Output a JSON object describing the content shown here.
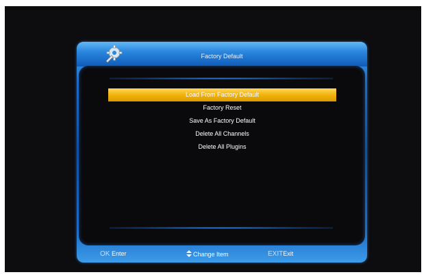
{
  "header": {
    "title": "Factory Default",
    "logo_icon": "gear-wrench-icon"
  },
  "menu": {
    "items": [
      {
        "label": "Load From Factory Default",
        "selected": true
      },
      {
        "label": "Factory Reset",
        "selected": false
      },
      {
        "label": "Save As Factory Default",
        "selected": false
      },
      {
        "label": "Delete All Channels",
        "selected": false
      },
      {
        "label": "Delete All Plugins",
        "selected": false
      }
    ]
  },
  "footer": {
    "ok_key": "OK",
    "ok_label": "Enter",
    "change_icon": "up-down-arrow-icon",
    "change_label": "Change Item",
    "exit_key": "EXIT",
    "exit_label": "Exit"
  },
  "colors": {
    "highlight": "#f2b20c",
    "frame_blue": "#1a6cc8",
    "background": "#0d0d0f"
  }
}
